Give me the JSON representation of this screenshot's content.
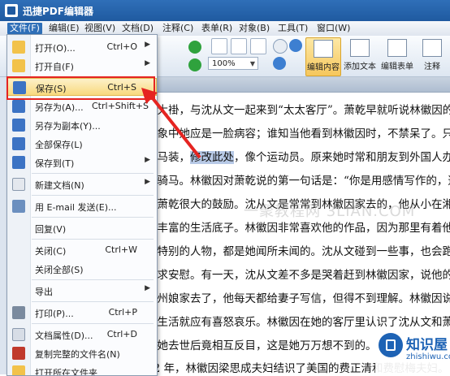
{
  "app": {
    "title": "迅捷PDF编辑器"
  },
  "menubar": [
    "文件(F)",
    "编辑(E)",
    "视图(V)",
    "文档(D)",
    "注释(C)",
    "表单(R)",
    "对象(B)",
    "工具(T)",
    "窗口(W)"
  ],
  "toolbar": {
    "zoom": "100%",
    "buttons": [
      "编辑内容",
      "添加文本",
      "编辑表单",
      "注释"
    ]
  },
  "file_menu": {
    "items": [
      {
        "label": "打开(O)...",
        "shortcut": "Ctrl+O",
        "icon": "folder-open-icon",
        "submenu": true
      },
      {
        "label": "打开自(F)",
        "shortcut": "",
        "icon": "folder-icon",
        "submenu": true
      },
      {
        "label": "保存(S)",
        "shortcut": "Ctrl+S",
        "icon": "save-icon",
        "submenu": false,
        "highlighted": true
      },
      {
        "label": "另存为(A)...",
        "shortcut": "Ctrl+Shift+S",
        "icon": "save-as-icon",
        "submenu": false
      },
      {
        "label": "另存为副本(Y)...",
        "shortcut": "",
        "icon": "save-copy-icon",
        "submenu": false
      },
      {
        "label": "全部保存(L)",
        "shortcut": "",
        "icon": "save-all-icon",
        "submenu": false
      },
      {
        "label": "保存到(T)",
        "shortcut": "",
        "icon": "save-to-icon",
        "submenu": true
      },
      {
        "label": "新建文档(N)",
        "shortcut": "",
        "icon": "new-document-icon",
        "submenu": true
      },
      {
        "label": "用 E-mail 发送(E)...",
        "shortcut": "",
        "icon": "email-icon",
        "submenu": false
      },
      {
        "label": "回复(V)",
        "shortcut": "",
        "icon": "",
        "submenu": false
      },
      {
        "label": "关闭(C)",
        "shortcut": "Ctrl+W",
        "icon": "",
        "submenu": false
      },
      {
        "label": "关闭全部(S)",
        "shortcut": "",
        "icon": "",
        "submenu": false
      },
      {
        "label": "导出",
        "shortcut": "",
        "icon": "",
        "submenu": true
      },
      {
        "label": "打印(P)...",
        "shortcut": "Ctrl+P",
        "icon": "printer-icon",
        "submenu": false
      },
      {
        "label": "文档属性(D)...",
        "shortcut": "Ctrl+D",
        "icon": "document-properties-icon",
        "submenu": false
      },
      {
        "label": "复制完整的文件名(N)",
        "shortcut": "",
        "icon": "copy-filename-icon",
        "submenu": false
      },
      {
        "label": "打开所在文件夹",
        "shortcut": "",
        "icon": "open-folder-icon",
        "submenu": false
      }
    ]
  },
  "document": {
    "lines": [
      "而大褂，与沈从文一起来到“太太客厅”。萧乾早就听说林徽因的",
      "想象中她应是一脸病容；谁知当他看到林徽因时，不禁呆了。只",
      "骑马装，",
      "修改此处",
      "，像个运动员。原来她时常和朋友到外国人办",
      "去骑马。林徽因对萧乾说的第一句话是：“你是用感情写作的，这",
      "了萧乾很大的鼓励。沈从文是常常到林徽因家去的，他从小在湘",
      "常丰富的生活底子。林徽因非常喜欢他的作品，因为那里有着他",
      "很特别的人物，都是她闻所未闻的。沈从文碰到一些事，也会跑",
      "寻求安慰。有一天，沈从文差不多是哭着赶到林徽因家，说他的",
      "苏州娘家去了，他每天都给妻子写信，但得不到理解。林徽因说",
      "，生活就应有喜怒哀乐。林徽因在她的客厅里认识了沈从文和萧",
      "在她去世后竟相互反目，这是她万万想不到的。",
      "32 年，林徽因梁思成夫妇结识了美国的费正清和费慰梅夫妇。",
      "住在同一条胡同里，费正清说：“",
      "我们旅居中国的经历中起着重要作"
    ],
    "watermark": "一聚教程网 3LIAN.COM",
    "badge_title": "知识屋",
    "badge_url": "zhishiwu.com"
  }
}
